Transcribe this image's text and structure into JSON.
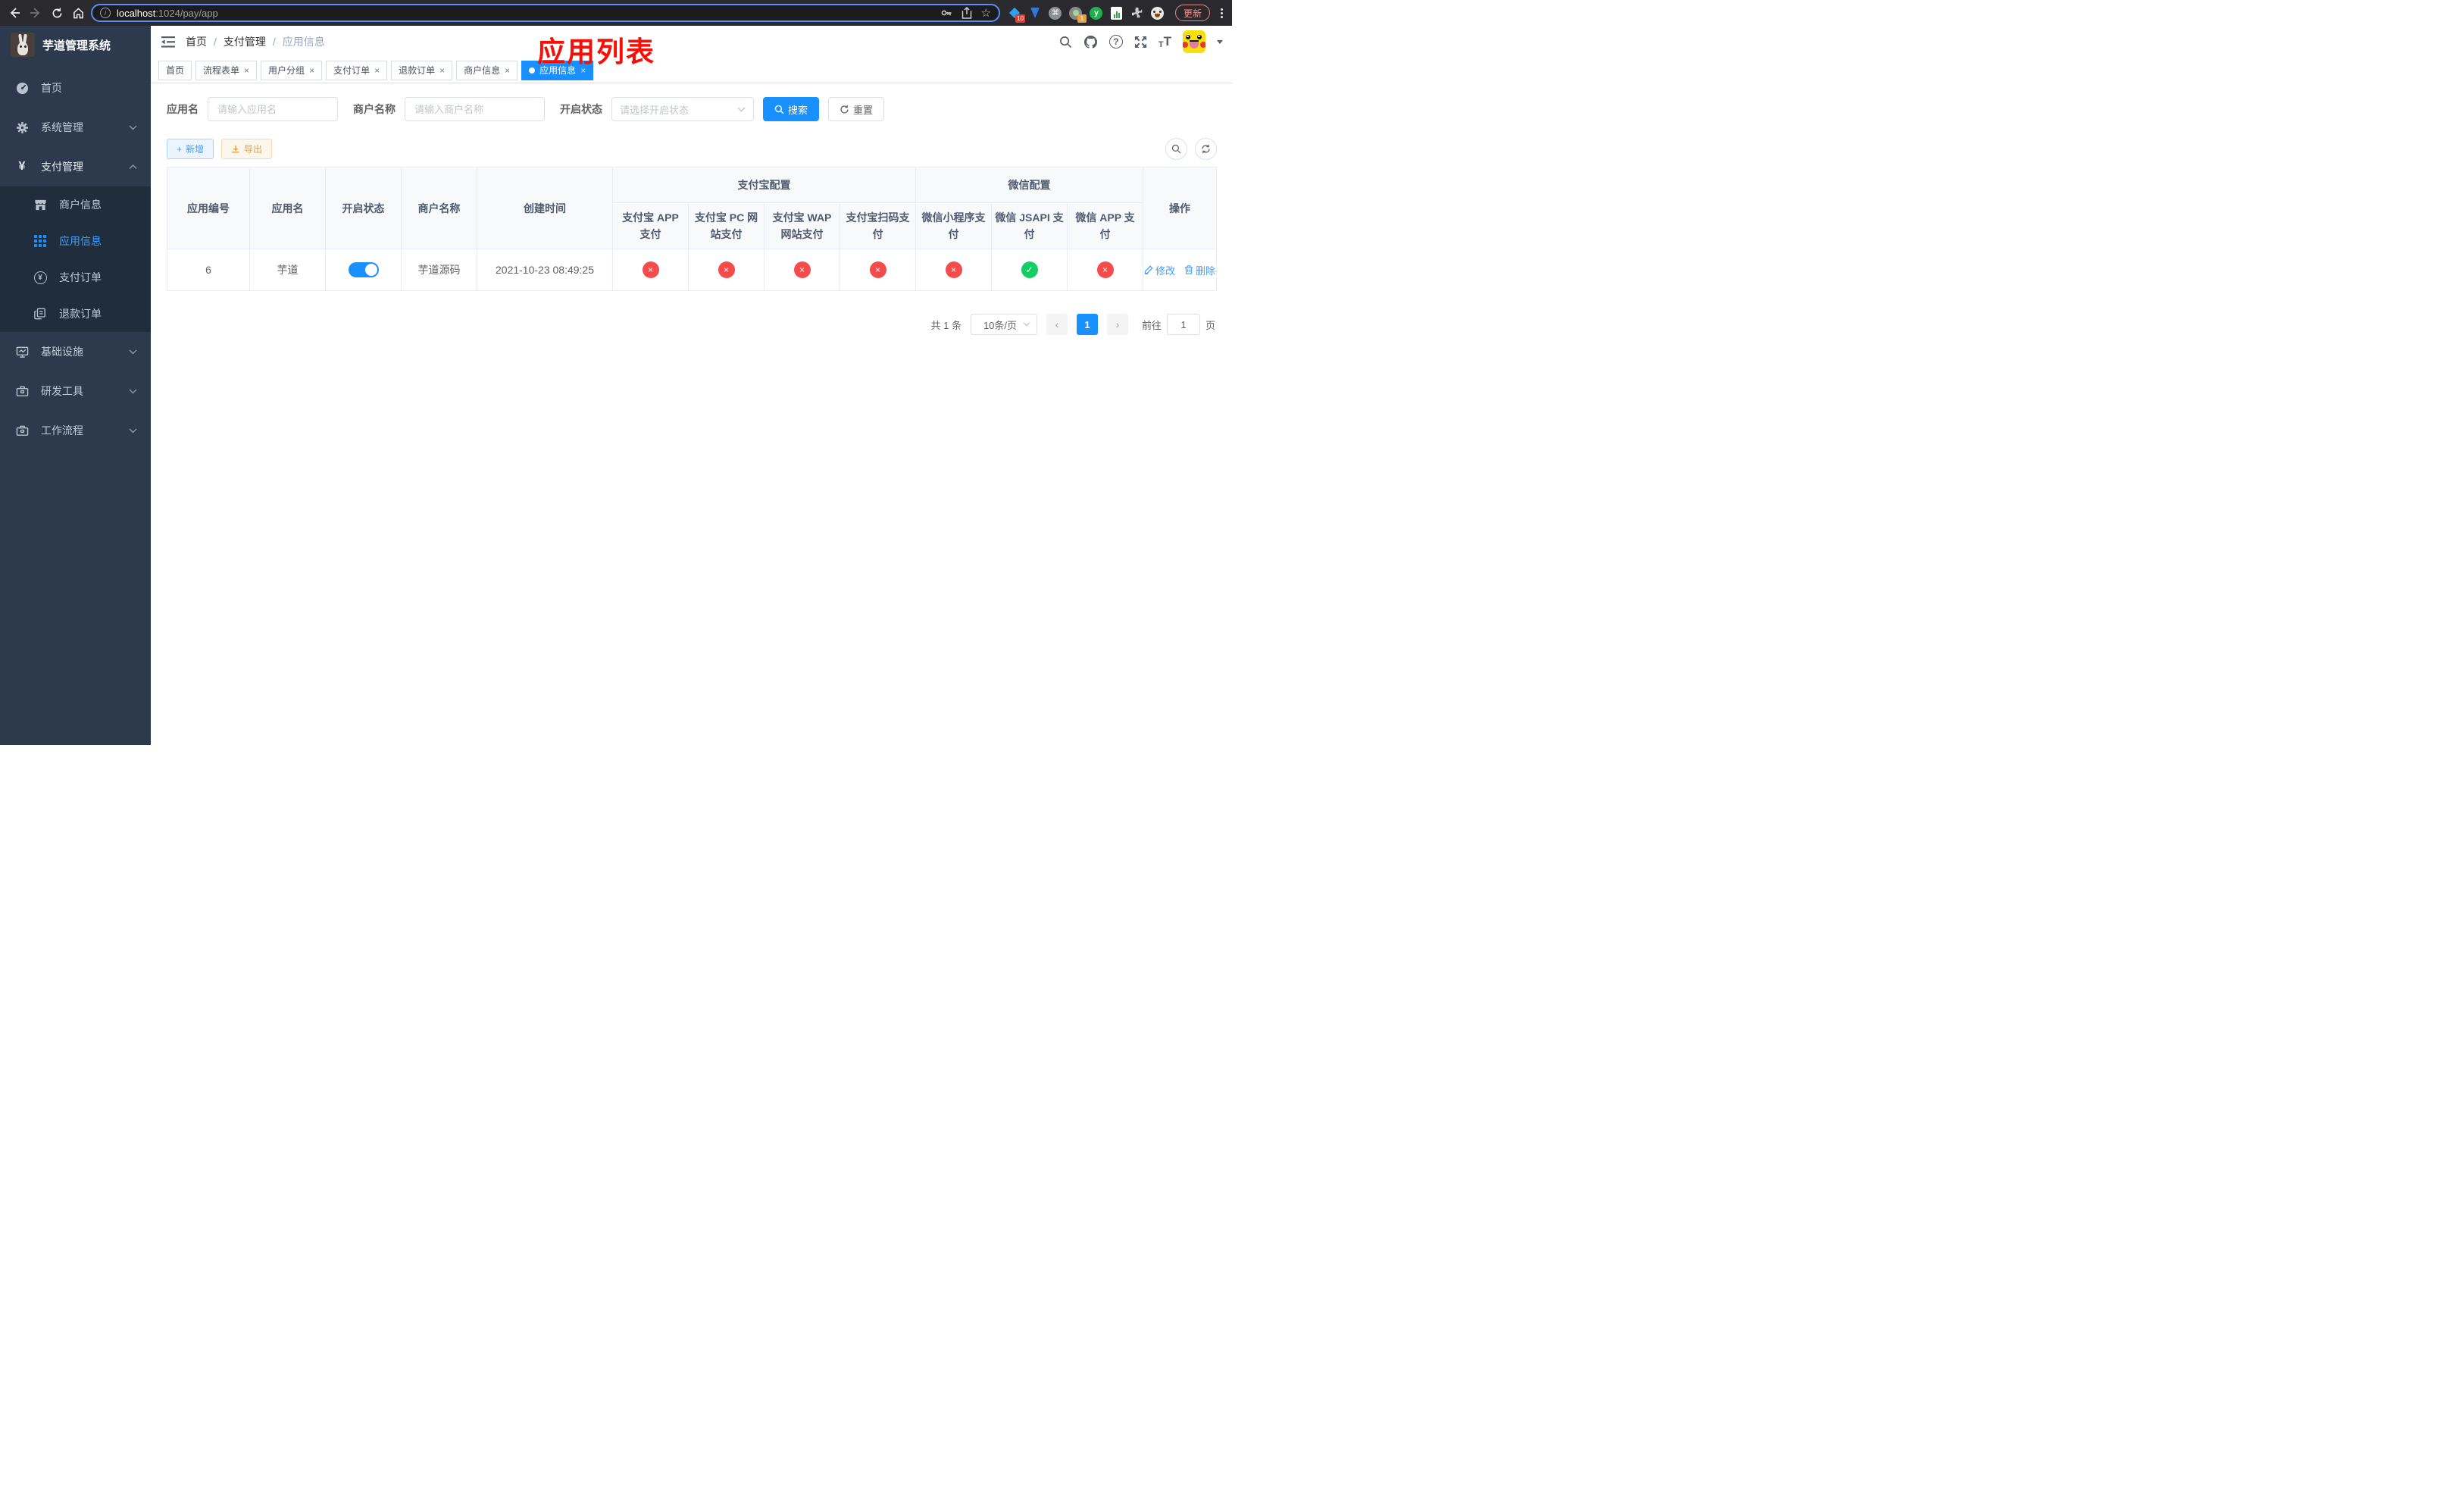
{
  "browser": {
    "url_host": "localhost",
    "url_rest": ":1024/pay/app",
    "update_label": "更新",
    "ext_badge_blue": "10",
    "ext_badge_gray": "1",
    "ext_y_letter": "y"
  },
  "icons": {
    "close": "×",
    "cross": "×",
    "check": "✓",
    "yen": "¥",
    "question": "?",
    "plus": "+",
    "prev": "‹",
    "next": "›",
    "star": "☆",
    "info": "i",
    "font_small": "T",
    "font_big": "T",
    "command": "⌘"
  },
  "sidebar": {
    "title": "芋道管理系统",
    "items": [
      {
        "label": "首页"
      },
      {
        "label": "系统管理"
      },
      {
        "label": "支付管理"
      },
      {
        "label": "商户信息"
      },
      {
        "label": "应用信息"
      },
      {
        "label": "支付订单"
      },
      {
        "label": "退款订单"
      },
      {
        "label": "基础设施"
      },
      {
        "label": "研发工具"
      },
      {
        "label": "工作流程"
      }
    ]
  },
  "header": {
    "breadcrumb": {
      "home": "首页",
      "section": "支付管理",
      "page": "应用信息"
    },
    "annotation": "应用列表"
  },
  "tabs": [
    {
      "label": "首页"
    },
    {
      "label": "流程表单"
    },
    {
      "label": "用户分组"
    },
    {
      "label": "支付订单"
    },
    {
      "label": "退款订单"
    },
    {
      "label": "商户信息"
    },
    {
      "label": "应用信息"
    }
  ],
  "filters": {
    "app_name_label": "应用名",
    "app_name_placeholder": "请输入应用名",
    "merchant_label": "商户名称",
    "merchant_placeholder": "请输入商户名称",
    "status_label": "开启状态",
    "status_placeholder": "请选择开启状态",
    "search_label": "搜索",
    "reset_label": "重置"
  },
  "toolbar": {
    "add_label": "新增",
    "export_label": "导出"
  },
  "table": {
    "headers": {
      "app_id": "应用编号",
      "app_name": "应用名",
      "status": "开启状态",
      "merchant": "商户名称",
      "create_time": "创建时间",
      "alipay_group": "支付宝配置",
      "wechat_group": "微信配置",
      "op": "操作",
      "channels": [
        "支付宝 APP 支付",
        "支付宝 PC 网站支付",
        "支付宝 WAP 网站支付",
        "支付宝扫码支付",
        "微信小程序支付",
        "微信 JSAPI 支付",
        "微信 APP 支付"
      ]
    },
    "row": {
      "app_id": "6",
      "app_name": "芋道",
      "status_on": "true",
      "merchant": "芋道源码",
      "create_time": "2021-10-23 08:49:25",
      "channels": [
        {
          "state": "off",
          "glyph": "×"
        },
        {
          "state": "off",
          "glyph": "×"
        },
        {
          "state": "off",
          "glyph": "×"
        },
        {
          "state": "off",
          "glyph": "×"
        },
        {
          "state": "off",
          "glyph": "×"
        },
        {
          "state": "on",
          "glyph": "✓"
        },
        {
          "state": "off",
          "glyph": "×"
        }
      ],
      "edit_label": "修改",
      "delete_label": "删除"
    }
  },
  "pagination": {
    "total_text": "共 1 条",
    "page_size": "10条/页",
    "current_page": "1",
    "jump_prefix": "前往",
    "jump_value": "1",
    "jump_suffix": "页"
  }
}
